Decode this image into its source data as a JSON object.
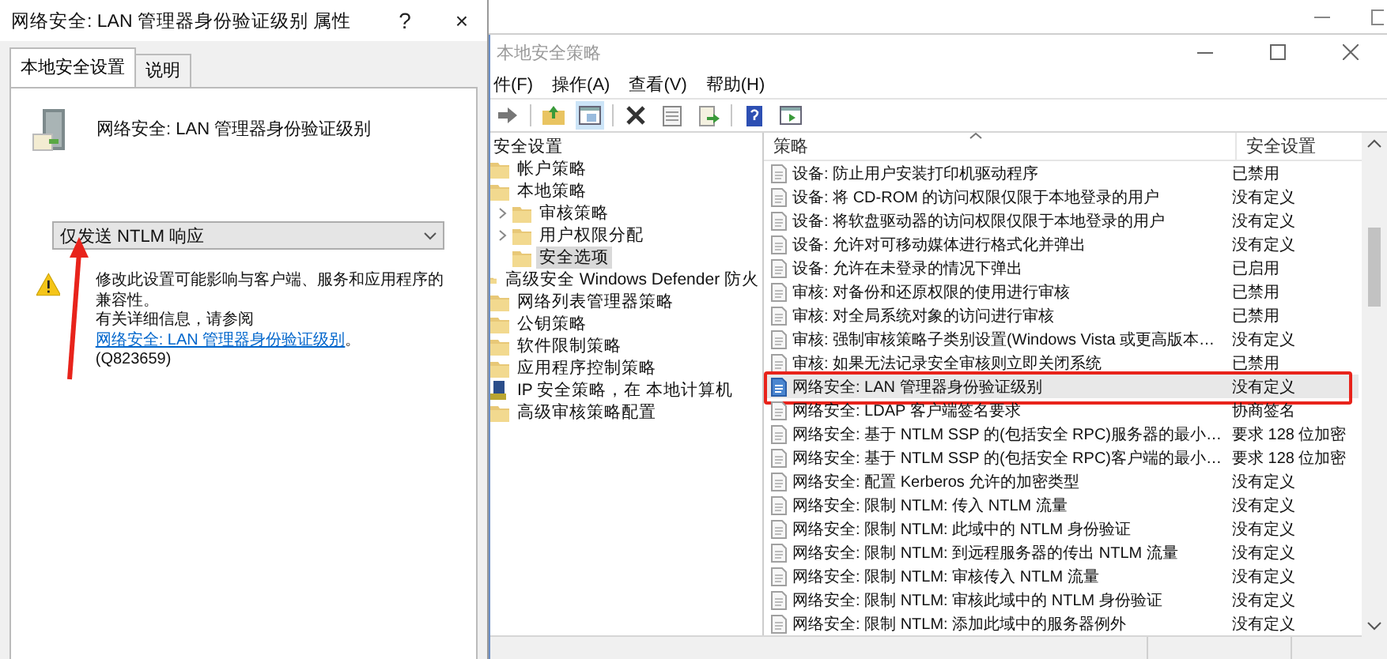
{
  "dialog": {
    "title": "网络安全: LAN 管理器身份验证级别 属性",
    "help": "?",
    "close": "×",
    "tabs": [
      {
        "label": "本地安全设置",
        "selected": true
      },
      {
        "label": "说明",
        "selected": false
      }
    ],
    "policy_name": "网络安全: LAN 管理器身份验证级别",
    "dropdown": {
      "value": "仅发送 NTLM 响应"
    },
    "warning": {
      "line_1": "修改此设置可能影响与客户端、服务和应用程序的兼容性。",
      "line_2": "有关详细信息，请参阅",
      "link": "网络安全: LAN 管理器身份验证级别",
      "line_2_end": "。",
      "reference": "(Q823659)"
    }
  },
  "console": {
    "title": "本地安全策略",
    "menu": [
      "件(F)",
      "操作(A)",
      "查看(V)",
      "帮助(H)"
    ],
    "tree": {
      "label": "安全设置",
      "children": [
        {
          "label": "帐户策略",
          "kind": "folder",
          "selected": false
        },
        {
          "label": "本地策略",
          "kind": "folder",
          "selected": false,
          "children": [
            {
              "label": "审核策略",
              "kind": "folder",
              "selected": false,
              "collapsed": true
            },
            {
              "label": "用户权限分配",
              "kind": "folder",
              "selected": false,
              "collapsed": true
            },
            {
              "label": "安全选项",
              "kind": "folder",
              "selected": true
            }
          ]
        },
        {
          "label": "高级安全 Windows Defender 防火",
          "kind": "folder",
          "selected": false
        },
        {
          "label": "网络列表管理器策略",
          "kind": "folder",
          "selected": false
        },
        {
          "label": "公钥策略",
          "kind": "folder",
          "selected": false
        },
        {
          "label": "软件限制策略",
          "kind": "folder",
          "selected": false
        },
        {
          "label": "应用程序控制策略",
          "kind": "folder",
          "selected": false
        },
        {
          "label": "IP 安全策略，在 本地计算机",
          "kind": "ip",
          "selected": false
        },
        {
          "label": "高级审核策略配置",
          "kind": "folder",
          "selected": false
        }
      ]
    },
    "columns": [
      "策略",
      "安全设置"
    ],
    "rows": [
      {
        "policy": "设备: 防止用户安装打印机驱动程序",
        "setting": "已禁用",
        "selected": false
      },
      {
        "policy": "设备: 将 CD-ROM 的访问权限仅限于本地登录的用户",
        "setting": "没有定义",
        "selected": false
      },
      {
        "policy": "设备: 将软盘驱动器的访问权限仅限于本地登录的用户",
        "setting": "没有定义",
        "selected": false
      },
      {
        "policy": "设备: 允许对可移动媒体进行格式化并弹出",
        "setting": "没有定义",
        "selected": false
      },
      {
        "policy": "设备: 允许在未登录的情况下弹出",
        "setting": "已启用",
        "selected": false
      },
      {
        "policy": "审核: 对备份和还原权限的使用进行审核",
        "setting": "已禁用",
        "selected": false
      },
      {
        "policy": "审核: 对全局系统对象的访问进行审核",
        "setting": "已禁用",
        "selected": false
      },
      {
        "policy": "审核: 强制审核策略子类别设置(Windows Vista 或更高版本…",
        "setting": "没有定义",
        "selected": false
      },
      {
        "policy": "审核: 如果无法记录安全审核则立即关闭系统",
        "setting": "已禁用",
        "selected": false
      },
      {
        "policy": "网络安全: LAN 管理器身份验证级别",
        "setting": "没有定义",
        "selected": true
      },
      {
        "policy": "网络安全: LDAP 客户端签名要求",
        "setting": "协商签名",
        "selected": false
      },
      {
        "policy": "网络安全: 基于 NTLM SSP 的(包括安全 RPC)服务器的最小…",
        "setting": "要求 128 位加密",
        "selected": false
      },
      {
        "policy": "网络安全: 基于 NTLM SSP 的(包括安全 RPC)客户端的最小…",
        "setting": "要求 128 位加密",
        "selected": false
      },
      {
        "policy": "网络安全: 配置 Kerberos 允许的加密类型",
        "setting": "没有定义",
        "selected": false
      },
      {
        "policy": "网络安全: 限制 NTLM: 传入 NTLM 流量",
        "setting": "没有定义",
        "selected": false
      },
      {
        "policy": "网络安全: 限制 NTLM: 此域中的 NTLM 身份验证",
        "setting": "没有定义",
        "selected": false
      },
      {
        "policy": "网络安全: 限制 NTLM: 到远程服务器的传出 NTLM 流量",
        "setting": "没有定义",
        "selected": false
      },
      {
        "policy": "网络安全: 限制 NTLM: 审核传入 NTLM 流量",
        "setting": "没有定义",
        "selected": false
      },
      {
        "policy": "网络安全: 限制 NTLM: 审核此域中的 NTLM 身份验证",
        "setting": "没有定义",
        "selected": false
      },
      {
        "policy": "网络安全: 限制 NTLM: 添加此域中的服务器例外",
        "setting": "没有定义",
        "selected": false
      }
    ]
  }
}
